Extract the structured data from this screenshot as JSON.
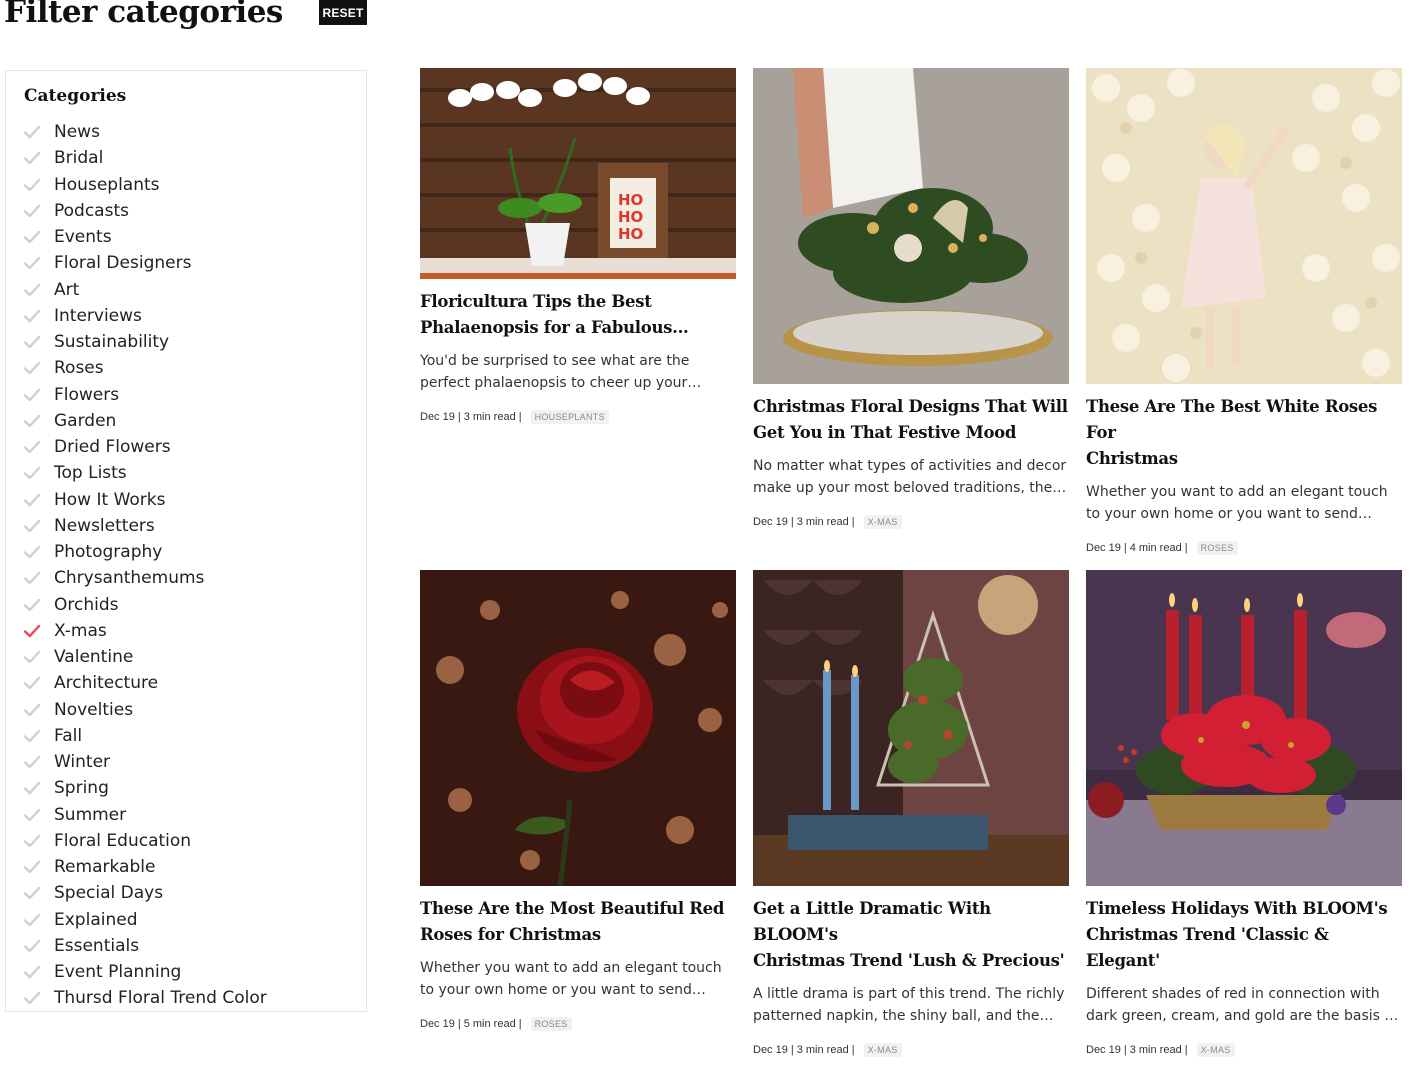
{
  "header": {
    "title": "Filter categories",
    "reset_label": "RESET"
  },
  "sidebar": {
    "heading": "Categories",
    "checked_color": "#f2455a",
    "unchecked_color": "#cfcfcf",
    "items": [
      {
        "label": "News",
        "checked": false
      },
      {
        "label": "Bridal",
        "checked": false
      },
      {
        "label": "Houseplants",
        "checked": false
      },
      {
        "label": "Podcasts",
        "checked": false
      },
      {
        "label": "Events",
        "checked": false
      },
      {
        "label": "Floral Designers",
        "checked": false
      },
      {
        "label": "Art",
        "checked": false
      },
      {
        "label": "Interviews",
        "checked": false
      },
      {
        "label": "Sustainability",
        "checked": false
      },
      {
        "label": "Roses",
        "checked": false
      },
      {
        "label": "Flowers",
        "checked": false
      },
      {
        "label": "Garden",
        "checked": false
      },
      {
        "label": "Dried Flowers",
        "checked": false
      },
      {
        "label": "Top Lists",
        "checked": false
      },
      {
        "label": "How It Works",
        "checked": false
      },
      {
        "label": "Newsletters",
        "checked": false
      },
      {
        "label": "Photography",
        "checked": false
      },
      {
        "label": "Chrysanthemums",
        "checked": false
      },
      {
        "label": "Orchids",
        "checked": false
      },
      {
        "label": "X-mas",
        "checked": true
      },
      {
        "label": "Valentine",
        "checked": false
      },
      {
        "label": "Architecture",
        "checked": false
      },
      {
        "label": "Novelties",
        "checked": false
      },
      {
        "label": "Fall",
        "checked": false
      },
      {
        "label": "Winter",
        "checked": false
      },
      {
        "label": "Spring",
        "checked": false
      },
      {
        "label": "Summer",
        "checked": false
      },
      {
        "label": "Floral Education",
        "checked": false
      },
      {
        "label": "Remarkable",
        "checked": false
      },
      {
        "label": "Special Days",
        "checked": false
      },
      {
        "label": "Explained",
        "checked": false
      },
      {
        "label": "Essentials",
        "checked": false
      },
      {
        "label": "Event Planning",
        "checked": false
      },
      {
        "label": "Thursd Floral Trend Color",
        "checked": false
      }
    ]
  },
  "articles": [
    {
      "title_line1": "Floricultura Tips the Best",
      "title_line2": "Phalaenopsis for a Fabulous...",
      "excerpt_line1": "You'd be surprised to see what are the",
      "excerpt_line2": "perfect phalaenopsis to cheer up your…",
      "date": "Dec 19",
      "read_time": "3 min read",
      "tag": "HOUSEPLANTS",
      "image": "white-orchid-ho-ho-ho-sign-photo",
      "sign_text": [
        "HO",
        "HO",
        "HO"
      ]
    },
    {
      "title_line1": "Christmas Floral Designs That Will",
      "title_line2": "Get You in That Festive Mood",
      "excerpt_line1": "No matter what types of activities and decor",
      "excerpt_line2": "make up your most beloved traditions, the…",
      "date": "Dec 19",
      "read_time": "3 min read",
      "tag": "X-MAS",
      "image": "christmas-tray-arrangement-photo"
    },
    {
      "title_line1": "These Are The Best White Roses For",
      "title_line2": "Christmas",
      "excerpt_line1": "Whether you want to add an elegant touch",
      "excerpt_line2": "to your own home or you want to send…",
      "date": "Dec 19",
      "read_time": "4 min read",
      "tag": "ROSES",
      "image": "white-rose-wall-photo"
    },
    {
      "title_line1": "These Are the Most Beautiful Red",
      "title_line2": "Roses for Christmas",
      "excerpt_line1": "Whether you want to add an elegant touch",
      "excerpt_line2": "to your own home or you want to send…",
      "date": "Dec 19",
      "read_time": "5 min read",
      "tag": "ROSES",
      "image": "red-rose-bokeh-photo"
    },
    {
      "title_line1": "Get a Little Dramatic With BLOOM's",
      "title_line2": "Christmas Trend 'Lush & Precious'",
      "excerpt_line1": "A little drama is part of this trend. The richly",
      "excerpt_line2": "patterned napkin, the shiny ball, and the…",
      "date": "Dec 19",
      "read_time": "3 min read",
      "tag": "X-MAS",
      "image": "lush-precious-tree-candles-photo"
    },
    {
      "title_line1": "Timeless Holidays With BLOOM's",
      "title_line2": "Christmas Trend 'Classic & Elegant'",
      "excerpt_line1": "Different shades of red in connection with",
      "excerpt_line2": "dark green, cream, and gold are the basis …",
      "date": "Dec 19",
      "read_time": "3 min read",
      "tag": "X-MAS",
      "image": "poinsettia-red-candles-photo"
    }
  ]
}
